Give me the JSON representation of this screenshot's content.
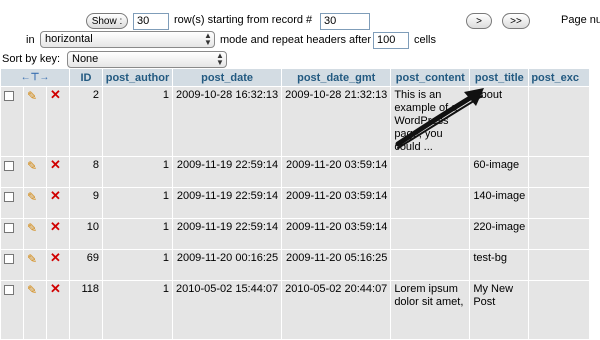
{
  "nav": {
    "show_label": "Show :",
    "rows_value": "30",
    "rows_text": "row(s) starting from record #",
    "start_value": "30",
    "next_label": ">",
    "last_label": ">>",
    "page_num_text": "Page nu",
    "in_text": "in",
    "mode_value": "horizontal",
    "mode_text": "mode and repeat headers after",
    "repeat_value": "100",
    "cells_text": "cells",
    "sort_label": "Sort by key:",
    "sort_value": "None"
  },
  "table": {
    "headers": [
      "ID",
      "post_author",
      "post_date",
      "post_date_gmt",
      "post_content",
      "post_title",
      "post_exc"
    ],
    "rows": [
      {
        "id": "2",
        "author": "1",
        "date": "2009-10-28 16:32:13",
        "gmt": "2009-10-28 21:32:13",
        "content": "This is an example of a WordPress page, you could ...",
        "title": "About"
      },
      {
        "id": "8",
        "author": "1",
        "date": "2009-11-19 22:59:14",
        "gmt": "2009-11-20 03:59:14",
        "content": "",
        "title": "60-image"
      },
      {
        "id": "9",
        "author": "1",
        "date": "2009-11-19 22:59:14",
        "gmt": "2009-11-20 03:59:14",
        "content": "",
        "title": "140-image"
      },
      {
        "id": "10",
        "author": "1",
        "date": "2009-11-19 22:59:14",
        "gmt": "2009-11-20 03:59:14",
        "content": "",
        "title": "220-image"
      },
      {
        "id": "69",
        "author": "1",
        "date": "2009-11-20 00:16:25",
        "gmt": "2009-11-20 05:16:25",
        "content": "",
        "title": "test-bg"
      },
      {
        "id": "118",
        "author": "1",
        "date": "2010-05-02 15:44:07",
        "gmt": "2010-05-02 20:44:07",
        "content": "Lorem ipsum dolor sit amet,",
        "title": "My New Post"
      }
    ]
  },
  "icons": {
    "checkbox": "checkbox-icon",
    "edit": "pencil-icon",
    "delete": "delete-x-icon"
  },
  "colors": {
    "header_bg": "#d3dce3",
    "header_text": "#235a81",
    "row_bg": "#e5e5e5"
  }
}
